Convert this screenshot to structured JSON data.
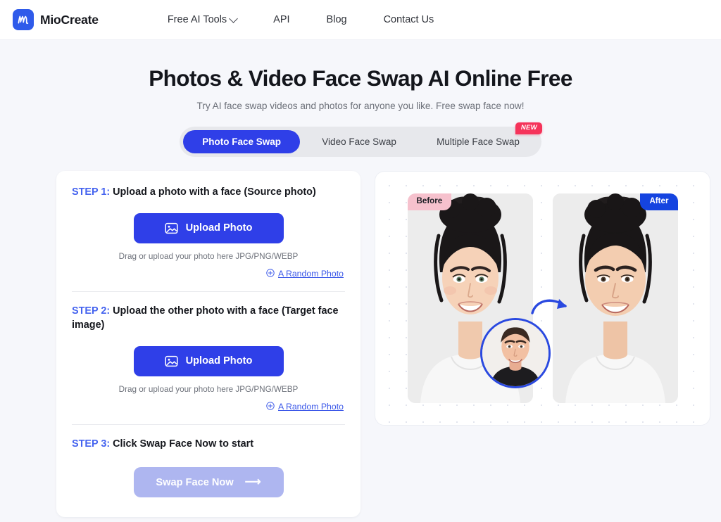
{
  "header": {
    "brand_name": "MioCreate",
    "logo_glyph": "m",
    "nav": [
      {
        "label": "Free AI Tools",
        "has_dropdown": true
      },
      {
        "label": "API",
        "has_dropdown": false
      },
      {
        "label": "Blog",
        "has_dropdown": false
      },
      {
        "label": "Contact Us",
        "has_dropdown": false
      }
    ]
  },
  "hero": {
    "title": "Photos & Video Face Swap AI Online Free",
    "subtitle": "Try AI face swap videos and photos for anyone you like. Free swap face now!"
  },
  "tabs": {
    "items": [
      {
        "label": "Photo Face Swap",
        "active": true,
        "badge": null
      },
      {
        "label": "Video Face Swap",
        "active": false,
        "badge": null
      },
      {
        "label": "Multiple Face Swap",
        "active": false,
        "badge": "NEW"
      }
    ]
  },
  "steps": [
    {
      "number": "STEP 1:",
      "text": " Upload a photo with a face (Source photo)",
      "button_label": "Upload Photo",
      "hint": "Drag or upload your photo here JPG/PNG/WEBP",
      "random_label": "A Random Photo"
    },
    {
      "number": "STEP 2:",
      "text": " Upload the other photo with a face (Target face image)",
      "button_label": "Upload Photo",
      "hint": "Drag or upload your photo here JPG/PNG/WEBP",
      "random_label": "A Random Photo"
    },
    {
      "number": "STEP 3:",
      "text": " Click Swap Face Now to start",
      "button_label": "Swap Face Now",
      "button_arrow": "⟶",
      "disabled": true
    }
  ],
  "preview": {
    "before_badge": "Before",
    "after_badge": "After"
  },
  "colors": {
    "brand_blue": "#2f3fe8",
    "link_blue": "#3a57e8",
    "badge_red": "#f5335a",
    "badge_pink": "#f6c1cd",
    "badge_blue": "#1544e0",
    "disabled_purple": "#aeb6f0",
    "page_bg": "#f6f7fb"
  }
}
